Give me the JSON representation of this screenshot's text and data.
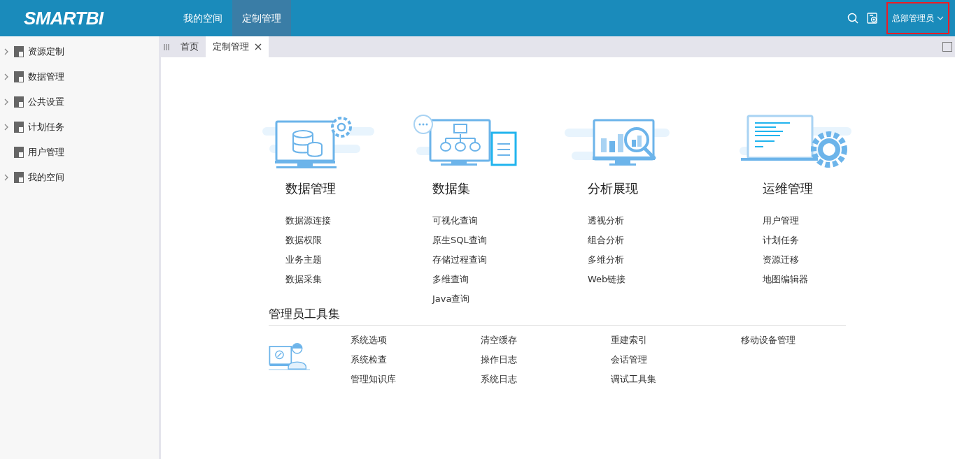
{
  "header": {
    "logo": "SMARTBI",
    "nav": [
      {
        "label": "我的空间",
        "selected": false
      },
      {
        "label": "定制管理",
        "selected": true
      }
    ],
    "user": {
      "name": "总部管理员",
      "highlighted": true
    }
  },
  "sidebar": {
    "items": [
      {
        "label": "资源定制",
        "expandable": true
      },
      {
        "label": "数据管理",
        "expandable": true
      },
      {
        "label": "公共设置",
        "expandable": true
      },
      {
        "label": "计划任务",
        "expandable": true
      },
      {
        "label": "用户管理",
        "expandable": false
      },
      {
        "label": "我的空间",
        "expandable": true
      }
    ]
  },
  "tabs": [
    {
      "label": "首页",
      "selected": false,
      "closable": false
    },
    {
      "label": "定制管理",
      "selected": true,
      "closable": true
    }
  ],
  "modules": [
    {
      "kind": "database",
      "title": "数据管理",
      "links": [
        "数据源连接",
        "数据权限",
        "业务主题",
        "数据采集"
      ]
    },
    {
      "kind": "dataset",
      "title": "数据集",
      "links": [
        "可视化查询",
        "原生SQL查询",
        "存储过程查询",
        "多维查询",
        "Java查询"
      ]
    },
    {
      "kind": "analysis",
      "title": "分析展现",
      "links": [
        "透视分析",
        "组合分析",
        "多维分析",
        "Web链接"
      ]
    },
    {
      "kind": "operations",
      "title": "运维管理",
      "links": [
        "用户管理",
        "计划任务",
        "资源迁移",
        "地图编辑器"
      ]
    }
  ],
  "admin_tools": {
    "title": "管理员工具集",
    "columns": [
      [
        "系统选项",
        "系统检查",
        "管理知识库"
      ],
      [
        "清空缓存",
        "操作日志",
        "系统日志"
      ],
      [
        "重建索引",
        "会话管理",
        "调试工具集"
      ],
      [
        "移动设备管理"
      ]
    ]
  }
}
